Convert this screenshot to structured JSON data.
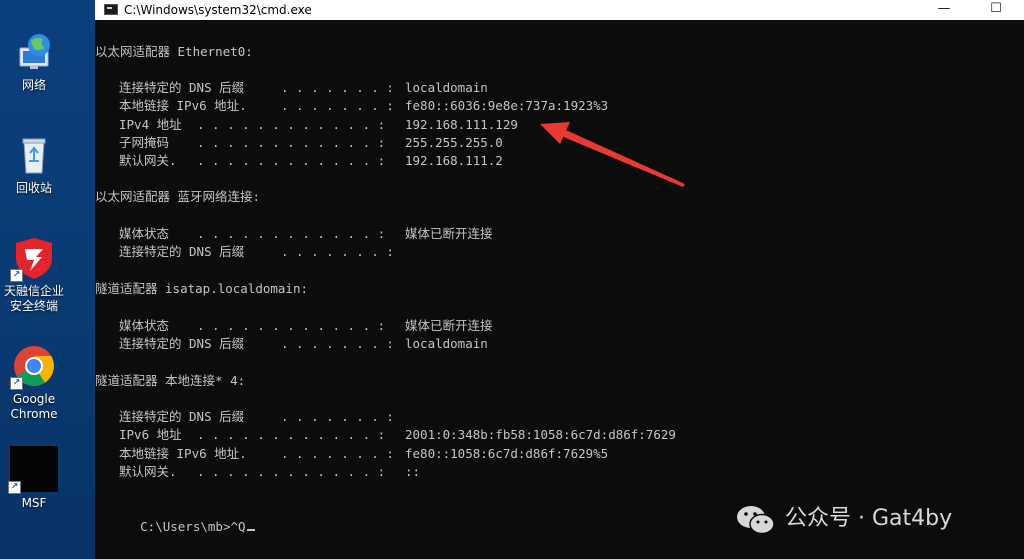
{
  "desktop": {
    "icons": [
      {
        "label": "网络"
      },
      {
        "label": "回收站"
      },
      {
        "label": "天融信企业安全终端"
      },
      {
        "label": "Google Chrome"
      },
      {
        "label": "MSF"
      }
    ]
  },
  "window": {
    "title": "C:\\Windows\\system32\\cmd.exe",
    "minimize": "—",
    "maximize": "☐"
  },
  "console": {
    "sections": [
      {
        "header": "以太网适配器 Ethernet0:",
        "rows": [
          {
            "label": "连接特定的 DNS 后缀",
            "dots": ". . . . . . . :",
            "value": "localdomain"
          },
          {
            "label": "本地链接 IPv6 地址.",
            "dots": ". . . . . . . :",
            "value": "fe80::6036:9e8e:737a:1923%3"
          },
          {
            "label": "IPv4 地址",
            "dots": ". . . . . . . . . . . . :",
            "value": "192.168.111.129"
          },
          {
            "label": "子网掩码",
            "dots": ". . . . . . . . . . . . :",
            "value": "255.255.255.0"
          },
          {
            "label": "默认网关.",
            "dots": ". . . . . . . . . . . . :",
            "value": "192.168.111.2"
          }
        ]
      },
      {
        "header": "以太网适配器 蓝牙网络连接:",
        "rows": [
          {
            "label": "媒体状态",
            "dots": ". . . . . . . . . . . . :",
            "value": "媒体已断开连接"
          },
          {
            "label": "连接特定的 DNS 后缀",
            "dots": ". . . . . . . :",
            "value": ""
          }
        ]
      },
      {
        "header": "隧道适配器 isatap.localdomain:",
        "rows": [
          {
            "label": "媒体状态",
            "dots": ". . . . . . . . . . . . :",
            "value": "媒体已断开连接"
          },
          {
            "label": "连接特定的 DNS 后缀",
            "dots": ". . . . . . . :",
            "value": "localdomain"
          }
        ]
      },
      {
        "header": "隧道适配器 本地连接* 4:",
        "rows": [
          {
            "label": "连接特定的 DNS 后缀",
            "dots": ". . . . . . . :",
            "value": ""
          },
          {
            "label": "IPv6 地址",
            "dots": ". . . . . . . . . . . . :",
            "value": "2001:0:348b:fb58:1058:6c7d:d86f:7629"
          },
          {
            "label": "本地链接 IPv6 地址.",
            "dots": ". . . . . . . :",
            "value": "fe80::1058:6c7d:d86f:7629%5"
          },
          {
            "label": "默认网关.",
            "dots": ". . . . . . . . . . . . :",
            "value": "::"
          }
        ]
      }
    ],
    "prompt": "C:\\Users\\mb>^Q"
  },
  "watermark": {
    "text": "公众号 · Gat4by"
  },
  "colors": {
    "console_bg": "#0c0c0c",
    "console_text": "#c4c4c4",
    "arrow": "#e83a30",
    "desktop_bg": "#0b3f7e"
  }
}
